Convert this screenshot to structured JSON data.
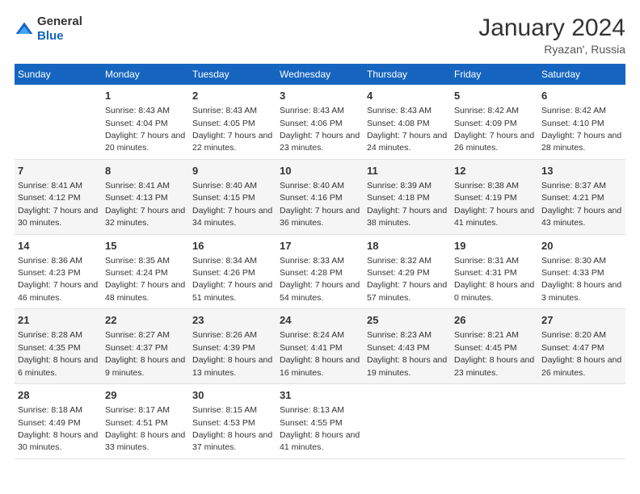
{
  "header": {
    "logo_general": "General",
    "logo_blue": "Blue",
    "title": "January 2024",
    "subtitle": "Ryazan', Russia"
  },
  "columns": [
    "Sunday",
    "Monday",
    "Tuesday",
    "Wednesday",
    "Thursday",
    "Friday",
    "Saturday"
  ],
  "weeks": [
    [
      {
        "day": "",
        "sunrise": "",
        "sunset": "",
        "daylight": ""
      },
      {
        "day": "1",
        "sunrise": "Sunrise: 8:43 AM",
        "sunset": "Sunset: 4:04 PM",
        "daylight": "Daylight: 7 hours and 20 minutes."
      },
      {
        "day": "2",
        "sunrise": "Sunrise: 8:43 AM",
        "sunset": "Sunset: 4:05 PM",
        "daylight": "Daylight: 7 hours and 22 minutes."
      },
      {
        "day": "3",
        "sunrise": "Sunrise: 8:43 AM",
        "sunset": "Sunset: 4:06 PM",
        "daylight": "Daylight: 7 hours and 23 minutes."
      },
      {
        "day": "4",
        "sunrise": "Sunrise: 8:43 AM",
        "sunset": "Sunset: 4:08 PM",
        "daylight": "Daylight: 7 hours and 24 minutes."
      },
      {
        "day": "5",
        "sunrise": "Sunrise: 8:42 AM",
        "sunset": "Sunset: 4:09 PM",
        "daylight": "Daylight: 7 hours and 26 minutes."
      },
      {
        "day": "6",
        "sunrise": "Sunrise: 8:42 AM",
        "sunset": "Sunset: 4:10 PM",
        "daylight": "Daylight: 7 hours and 28 minutes."
      }
    ],
    [
      {
        "day": "7",
        "sunrise": "Sunrise: 8:41 AM",
        "sunset": "Sunset: 4:12 PM",
        "daylight": "Daylight: 7 hours and 30 minutes."
      },
      {
        "day": "8",
        "sunrise": "Sunrise: 8:41 AM",
        "sunset": "Sunset: 4:13 PM",
        "daylight": "Daylight: 7 hours and 32 minutes."
      },
      {
        "day": "9",
        "sunrise": "Sunrise: 8:40 AM",
        "sunset": "Sunset: 4:15 PM",
        "daylight": "Daylight: 7 hours and 34 minutes."
      },
      {
        "day": "10",
        "sunrise": "Sunrise: 8:40 AM",
        "sunset": "Sunset: 4:16 PM",
        "daylight": "Daylight: 7 hours and 36 minutes."
      },
      {
        "day": "11",
        "sunrise": "Sunrise: 8:39 AM",
        "sunset": "Sunset: 4:18 PM",
        "daylight": "Daylight: 7 hours and 38 minutes."
      },
      {
        "day": "12",
        "sunrise": "Sunrise: 8:38 AM",
        "sunset": "Sunset: 4:19 PM",
        "daylight": "Daylight: 7 hours and 41 minutes."
      },
      {
        "day": "13",
        "sunrise": "Sunrise: 8:37 AM",
        "sunset": "Sunset: 4:21 PM",
        "daylight": "Daylight: 7 hours and 43 minutes."
      }
    ],
    [
      {
        "day": "14",
        "sunrise": "Sunrise: 8:36 AM",
        "sunset": "Sunset: 4:23 PM",
        "daylight": "Daylight: 7 hours and 46 minutes."
      },
      {
        "day": "15",
        "sunrise": "Sunrise: 8:35 AM",
        "sunset": "Sunset: 4:24 PM",
        "daylight": "Daylight: 7 hours and 48 minutes."
      },
      {
        "day": "16",
        "sunrise": "Sunrise: 8:34 AM",
        "sunset": "Sunset: 4:26 PM",
        "daylight": "Daylight: 7 hours and 51 minutes."
      },
      {
        "day": "17",
        "sunrise": "Sunrise: 8:33 AM",
        "sunset": "Sunset: 4:28 PM",
        "daylight": "Daylight: 7 hours and 54 minutes."
      },
      {
        "day": "18",
        "sunrise": "Sunrise: 8:32 AM",
        "sunset": "Sunset: 4:29 PM",
        "daylight": "Daylight: 7 hours and 57 minutes."
      },
      {
        "day": "19",
        "sunrise": "Sunrise: 8:31 AM",
        "sunset": "Sunset: 4:31 PM",
        "daylight": "Daylight: 8 hours and 0 minutes."
      },
      {
        "day": "20",
        "sunrise": "Sunrise: 8:30 AM",
        "sunset": "Sunset: 4:33 PM",
        "daylight": "Daylight: 8 hours and 3 minutes."
      }
    ],
    [
      {
        "day": "21",
        "sunrise": "Sunrise: 8:28 AM",
        "sunset": "Sunset: 4:35 PM",
        "daylight": "Daylight: 8 hours and 6 minutes."
      },
      {
        "day": "22",
        "sunrise": "Sunrise: 8:27 AM",
        "sunset": "Sunset: 4:37 PM",
        "daylight": "Daylight: 8 hours and 9 minutes."
      },
      {
        "day": "23",
        "sunrise": "Sunrise: 8:26 AM",
        "sunset": "Sunset: 4:39 PM",
        "daylight": "Daylight: 8 hours and 13 minutes."
      },
      {
        "day": "24",
        "sunrise": "Sunrise: 8:24 AM",
        "sunset": "Sunset: 4:41 PM",
        "daylight": "Daylight: 8 hours and 16 minutes."
      },
      {
        "day": "25",
        "sunrise": "Sunrise: 8:23 AM",
        "sunset": "Sunset: 4:43 PM",
        "daylight": "Daylight: 8 hours and 19 minutes."
      },
      {
        "day": "26",
        "sunrise": "Sunrise: 8:21 AM",
        "sunset": "Sunset: 4:45 PM",
        "daylight": "Daylight: 8 hours and 23 minutes."
      },
      {
        "day": "27",
        "sunrise": "Sunrise: 8:20 AM",
        "sunset": "Sunset: 4:47 PM",
        "daylight": "Daylight: 8 hours and 26 minutes."
      }
    ],
    [
      {
        "day": "28",
        "sunrise": "Sunrise: 8:18 AM",
        "sunset": "Sunset: 4:49 PM",
        "daylight": "Daylight: 8 hours and 30 minutes."
      },
      {
        "day": "29",
        "sunrise": "Sunrise: 8:17 AM",
        "sunset": "Sunset: 4:51 PM",
        "daylight": "Daylight: 8 hours and 33 minutes."
      },
      {
        "day": "30",
        "sunrise": "Sunrise: 8:15 AM",
        "sunset": "Sunset: 4:53 PM",
        "daylight": "Daylight: 8 hours and 37 minutes."
      },
      {
        "day": "31",
        "sunrise": "Sunrise: 8:13 AM",
        "sunset": "Sunset: 4:55 PM",
        "daylight": "Daylight: 8 hours and 41 minutes."
      },
      {
        "day": "",
        "sunrise": "",
        "sunset": "",
        "daylight": ""
      },
      {
        "day": "",
        "sunrise": "",
        "sunset": "",
        "daylight": ""
      },
      {
        "day": "",
        "sunrise": "",
        "sunset": "",
        "daylight": ""
      }
    ]
  ]
}
